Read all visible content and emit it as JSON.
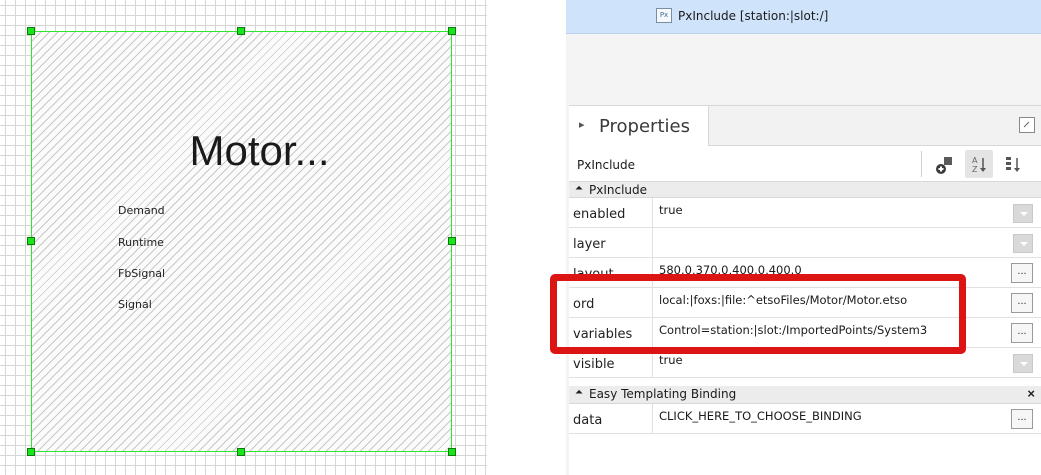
{
  "canvas": {
    "widget_title": "Motor...",
    "signal_labels": [
      "Demand",
      "Runtime",
      "FbSignal",
      "Signal"
    ]
  },
  "nav": {
    "icon_text": "Px",
    "path": "PxInclude [station:|slot:/]"
  },
  "properties_panel": {
    "title": "Properties",
    "object_type": "PxInclude",
    "sections": [
      {
        "title": "PxInclude",
        "rows": [
          {
            "name": "enabled",
            "value": "true",
            "editor": "dropdown"
          },
          {
            "name": "layer",
            "value": "",
            "editor": "dropdown"
          },
          {
            "name": "layout",
            "value": "580.0,370.0,400.0,400.0",
            "editor": "dialog"
          },
          {
            "name": "ord",
            "value": "local:|foxs:|file:^etsoFiles/Motor/Motor.etso",
            "editor": "dialog"
          },
          {
            "name": "variables",
            "value": "Control=station:|slot:/ImportedPoints/System3",
            "editor": "dialog"
          },
          {
            "name": "visible",
            "value": "true",
            "editor": "dropdown"
          }
        ]
      },
      {
        "title": "Easy Templating Binding",
        "close_glyph": "×",
        "rows": [
          {
            "name": "data",
            "value": "CLICK_HERE_TO_CHOOSE_BINDING",
            "editor": "dialog"
          }
        ]
      }
    ],
    "dialog_button_label": "...",
    "collapse_glyph": "▸",
    "section_collapse_glyph": "⏶"
  },
  "colors": {
    "selection_handle": "#19e619",
    "highlight_annotation": "#dd1414",
    "nav_background": "#cfe3fb"
  }
}
